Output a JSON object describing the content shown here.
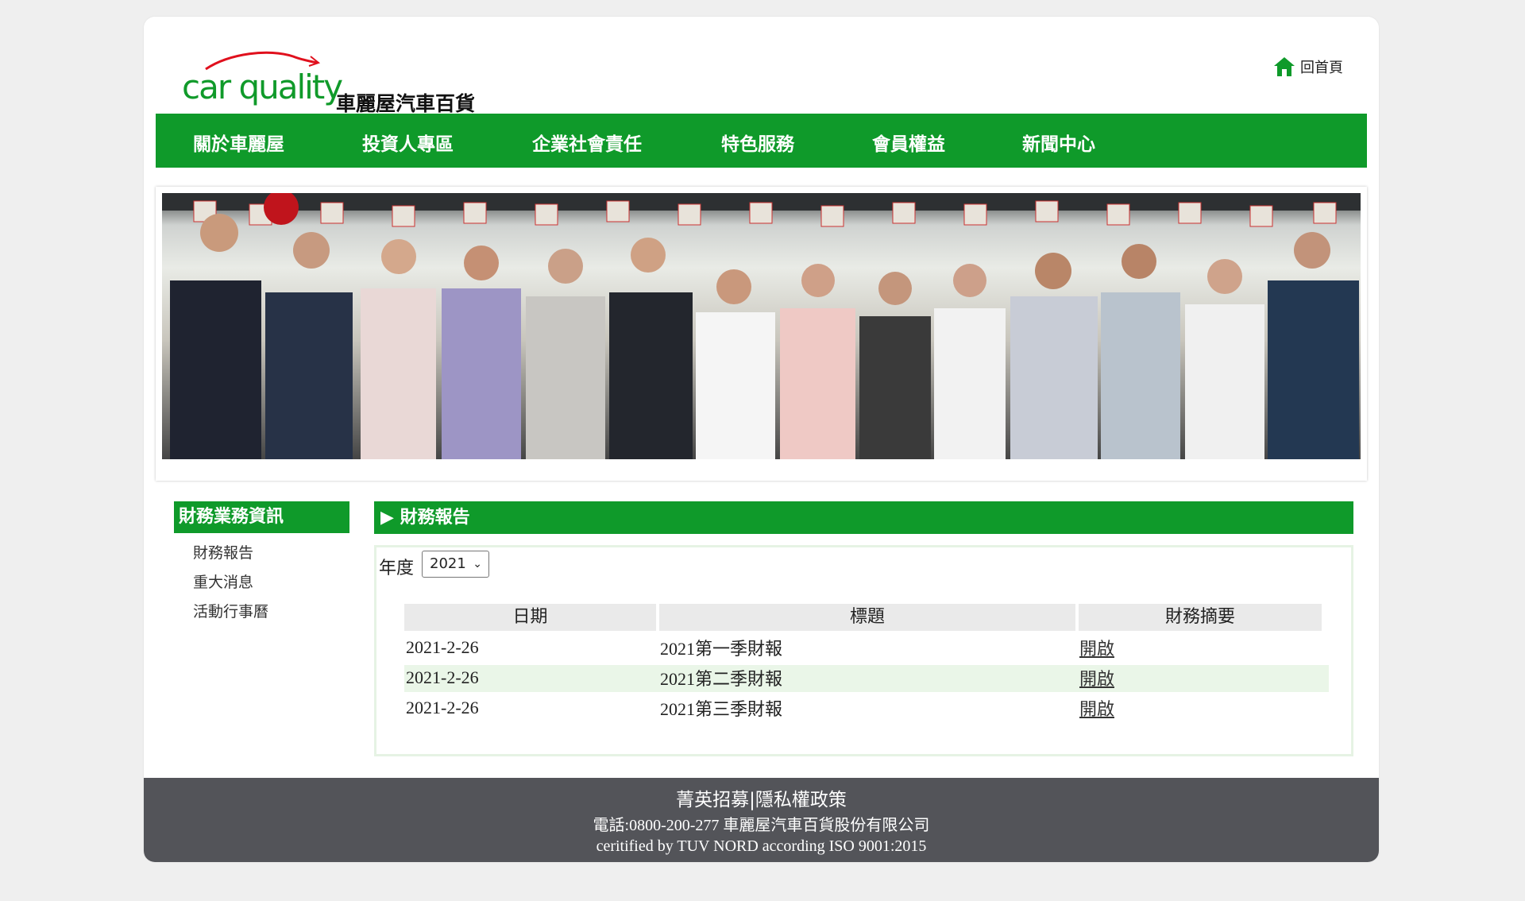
{
  "header": {
    "logo_en": "car quality",
    "logo_zh": "車麗屋汽車百貨",
    "home_label": "回首頁"
  },
  "nav": {
    "items": [
      "關於車麗屋",
      "投資人專區",
      "企業社會責任",
      "特色服務",
      "會員權益",
      "新聞中心"
    ]
  },
  "sidebar": {
    "title": "財務業務資訊",
    "items": [
      "財務報告",
      "重大消息",
      "活動行事曆"
    ]
  },
  "main": {
    "title": "▶ 財務報告",
    "year_label": "年度",
    "year_selected": "2021",
    "columns": [
      "日期",
      "標題",
      "財務摘要"
    ],
    "rows": [
      {
        "date": "2021-2-26",
        "title": "2021第一季財報",
        "link": "開啟"
      },
      {
        "date": "2021-2-26",
        "title": "2021第二季財報",
        "link": "開啟"
      },
      {
        "date": "2021-2-26",
        "title": "2021第三季財報",
        "link": "開啟"
      }
    ]
  },
  "footer": {
    "recruit": "菁英招募",
    "separator": "|",
    "privacy": "隱私權政策",
    "contact": "電話:0800-200-277 車麗屋汽車百貨股份有限公司",
    "cert": "ceritified by TUV NORD according ISO 9001:2015"
  },
  "colors": {
    "brand_green": "#0f9a2a",
    "footer_gray": "#535459",
    "logo_red": "#e0101d"
  }
}
